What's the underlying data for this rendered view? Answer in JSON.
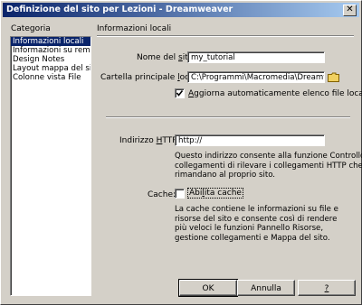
{
  "window": {
    "title": "Definizione del sito per Lezioni - Dreamweaver",
    "close_glyph": "✕"
  },
  "sidebar": {
    "heading": "Categoria",
    "items": [
      {
        "label": "Informazioni locali",
        "selected": true
      },
      {
        "label": "Informazioni su remoto"
      },
      {
        "label": "Design Notes"
      },
      {
        "label": "Layout mappa del sito"
      },
      {
        "label": "Colonne vista File"
      }
    ]
  },
  "main": {
    "heading": "Informazioni locali",
    "site_name_label": "Nome del sito:",
    "site_name_value": "my_tutorial",
    "root_folder_label": "Cartella principale locale:",
    "root_folder_value": "C:\\Programmi\\Macromedia\\Dreamwea",
    "auto_refresh_label": "Aggiorna automaticamente elenco file locali",
    "auto_refresh_checked": true,
    "http_label": "Indirizzo HTTP:",
    "http_value": "http://",
    "http_desc": [
      "Questo indirizzo consente alla funzione Controllo",
      "collegamenti di rilevare i collegamenti HTTP che",
      "rimandano al proprio sito."
    ],
    "cache_label": "Cache:",
    "cache_checkbox_label": "Abilita cache",
    "cache_checked": false,
    "cache_desc": [
      "La cache contiene le informazioni su file e",
      "risorse del sito e consente così di rendere",
      "più veloci le funzioni Pannello Risorse,",
      "gestione collegamenti e Mappa del sito."
    ]
  },
  "buttons": {
    "ok": "OK",
    "cancel": "Annulla",
    "help": "?"
  }
}
